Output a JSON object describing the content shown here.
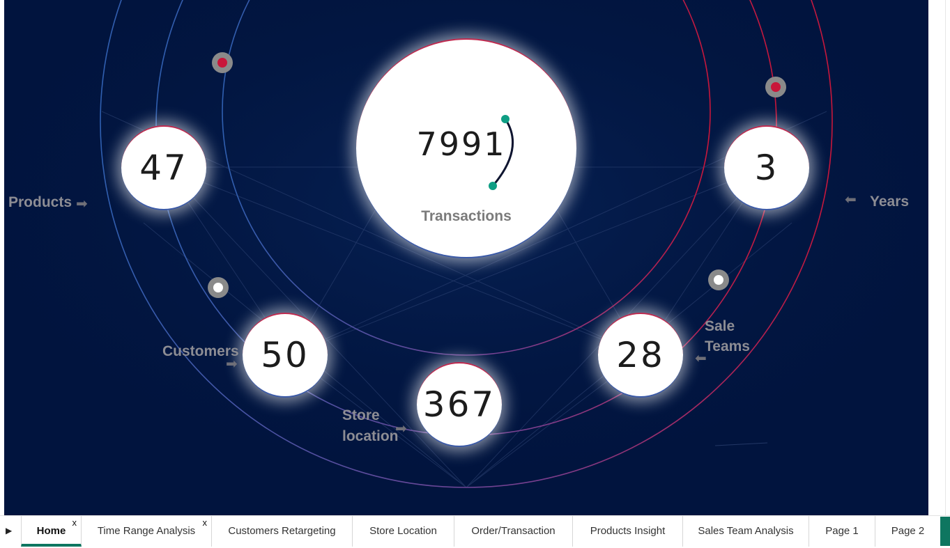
{
  "metrics": {
    "transactions": {
      "value": "7991",
      "label": "Transactions"
    },
    "products": {
      "value": "47",
      "label": "Products"
    },
    "years": {
      "value": "3",
      "label": "Years"
    },
    "customers": {
      "value": "50",
      "label": "Customers"
    },
    "store_location": {
      "value": "367",
      "label_line1": "Store",
      "label_line2": "location"
    },
    "sale_teams": {
      "value": "28",
      "label_line1": "Sale",
      "label_line2": "Teams"
    }
  },
  "icons": {
    "arrow_right": "➡",
    "arrow_left": "⬅",
    "tab_scroll": "▶"
  },
  "colors": {
    "background": "#01143e",
    "accent_red": "#c8163a",
    "accent_teal": "#0e9e84",
    "tab_active": "#0e7660"
  },
  "tabs": [
    {
      "label": "Home",
      "active": true,
      "close": "x"
    },
    {
      "label": "Time Range Analysis",
      "active": false,
      "close": "x"
    },
    {
      "label": "Customers Retargeting",
      "active": false
    },
    {
      "label": "Store Location",
      "active": false
    },
    {
      "label": "Order/Transaction",
      "active": false
    },
    {
      "label": "Products Insight",
      "active": false
    },
    {
      "label": "Sales Team Analysis",
      "active": false
    },
    {
      "label": "Page 1",
      "active": false
    },
    {
      "label": "Page 2",
      "active": false
    }
  ]
}
